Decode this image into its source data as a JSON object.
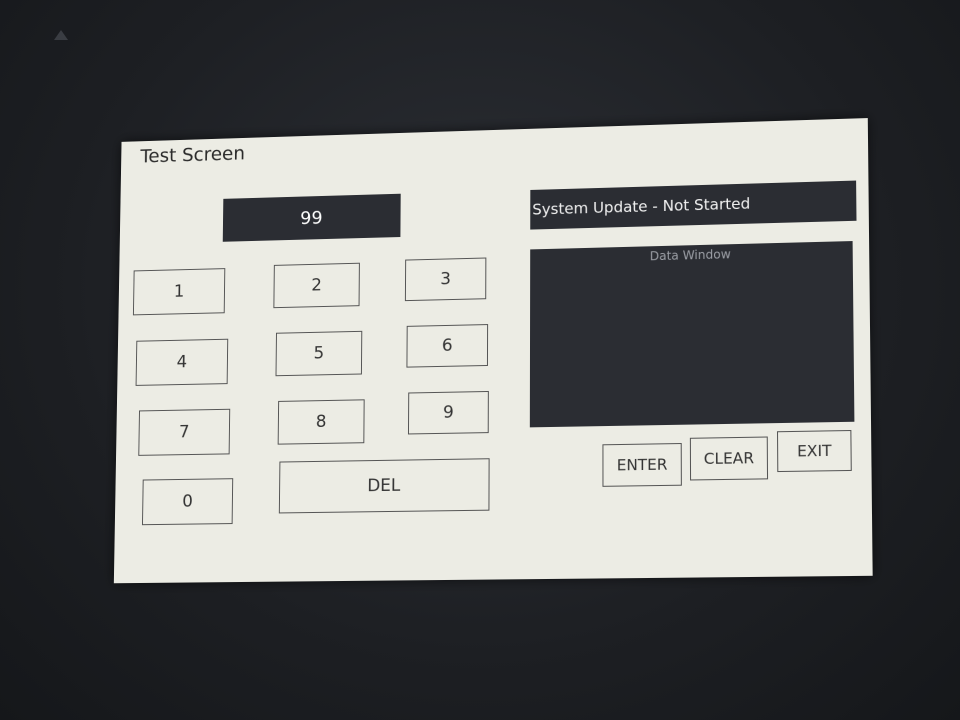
{
  "window": {
    "title": "Test Screen"
  },
  "keypad": {
    "display_value": "99",
    "keys": [
      "1",
      "2",
      "3",
      "4",
      "5",
      "6",
      "7",
      "8",
      "9",
      "0"
    ],
    "del_label": "DEL"
  },
  "status": {
    "text": "System Update - Not Started"
  },
  "data_window": {
    "label": "Data Window"
  },
  "actions": {
    "enter_label": "ENTER",
    "clear_label": "CLEAR",
    "exit_label": "EXIT"
  },
  "colors": {
    "screen_bg": "#ecece4",
    "panel_dark": "#2b2d33",
    "bezel": "#1e2024"
  }
}
